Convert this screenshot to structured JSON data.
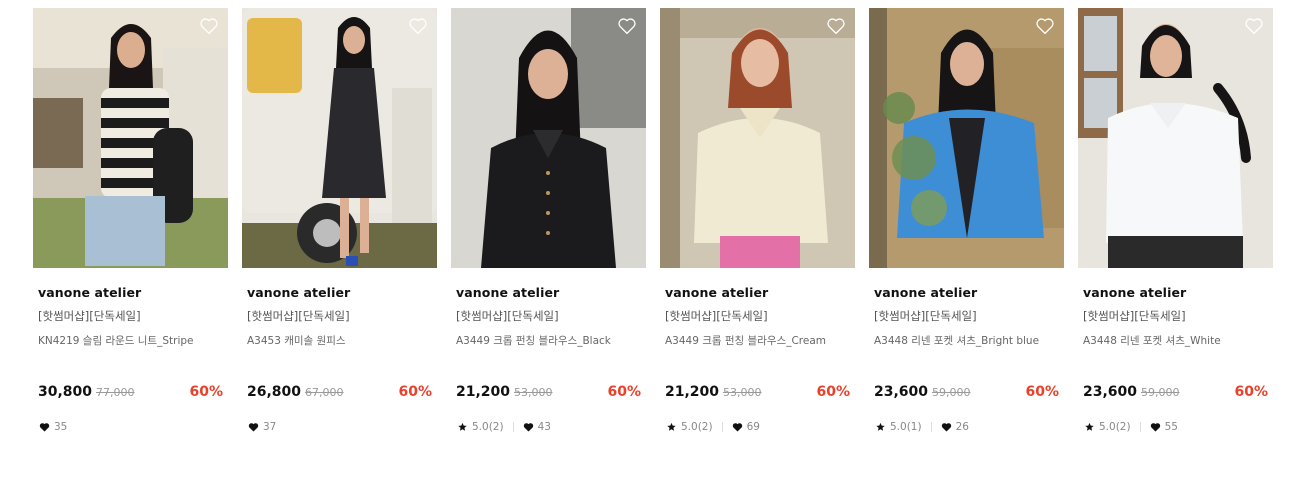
{
  "colors": {
    "discount": "#e8412c",
    "price": "#111111",
    "original_price": "#9a9a9a",
    "meta": "#888888"
  },
  "icons": {
    "wishlist": "heart-outline-icon",
    "rating": "star-icon",
    "likes": "heart-filled-icon"
  },
  "products": [
    {
      "brand": "vanone atelier",
      "tag": "[핫썸머샵][단독세일]",
      "name": "KN4219 슬림 라운드 니트_Stripe",
      "price": "30,800",
      "original_price": "77,000",
      "discount": "60%",
      "rating": null,
      "likes": "35"
    },
    {
      "brand": "vanone atelier",
      "tag": "[핫썸머샵][단독세일]",
      "name": "A3453 캐미솔 원피스",
      "price": "26,800",
      "original_price": "67,000",
      "discount": "60%",
      "rating": null,
      "likes": "37"
    },
    {
      "brand": "vanone atelier",
      "tag": "[핫썸머샵][단독세일]",
      "name": "A3449 크롭 펀칭 블라우스_Black",
      "price": "21,200",
      "original_price": "53,000",
      "discount": "60%",
      "rating": "5.0(2)",
      "likes": "43"
    },
    {
      "brand": "vanone atelier",
      "tag": "[핫썸머샵][단독세일]",
      "name": "A3449 크롭 펀칭 블라우스_Cream",
      "price": "21,200",
      "original_price": "53,000",
      "discount": "60%",
      "rating": "5.0(2)",
      "likes": "69"
    },
    {
      "brand": "vanone atelier",
      "tag": "[핫썸머샵][단독세일]",
      "name": "A3448 리넨 포켓 셔츠_Bright blue",
      "price": "23,600",
      "original_price": "59,000",
      "discount": "60%",
      "rating": "5.0(1)",
      "likes": "26"
    },
    {
      "brand": "vanone atelier",
      "tag": "[핫썸머샵][단독세일]",
      "name": "A3448 리넨 포켓 셔츠_White",
      "price": "23,600",
      "original_price": "59,000",
      "discount": "60%",
      "rating": "5.0(2)",
      "likes": "55"
    }
  ]
}
